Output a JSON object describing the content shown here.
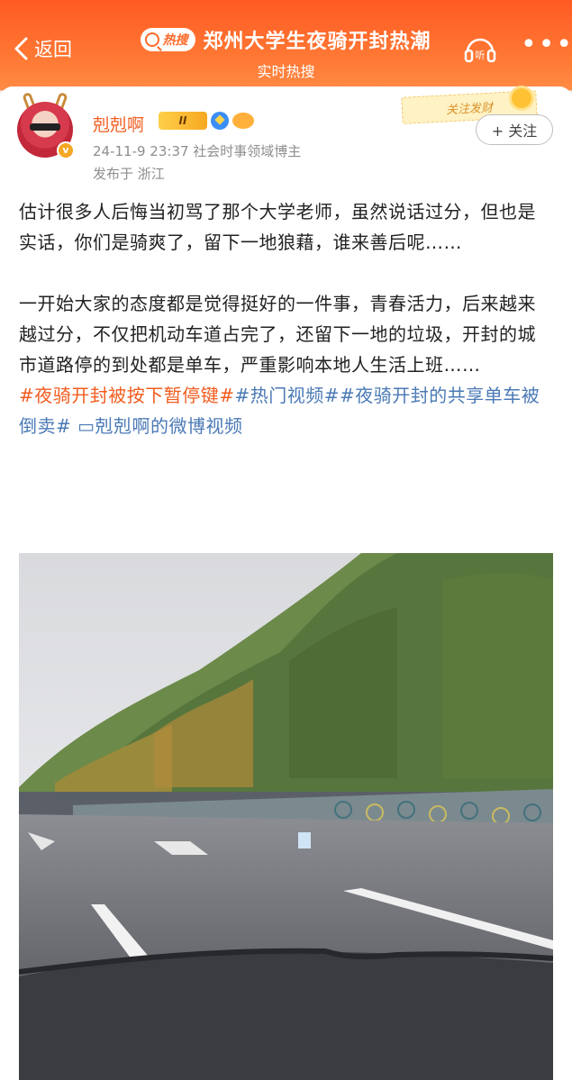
{
  "header": {
    "back_label": "返回",
    "hot_badge": "热搜",
    "title": "郑州大学生夜骑开封热潮",
    "subtitle": "实时热搜",
    "listen_label": "听",
    "more_label": "•••"
  },
  "post": {
    "username": "剋剋啊",
    "level_badge": "II",
    "banner_text": "关注发财",
    "follow_label": "+ 关注",
    "meta_line": "24-11-9 23:37  社会时事领域博主",
    "location": "发布于 浙江",
    "paragraph1": "估计很多人后悔当初骂了那个大学老师，虽然说话过分，但也是实话，你们是骑爽了，留下一地狼藉，谁来善后呢……",
    "paragraph2": "一开始大家的态度都是觉得挺好的一件事，青春活力，后来越来越过分，不仅把机动车道占完了，还留下一地的垃圾，开封的城市道路停的到处都是单车，严重影响本地人生活上班……",
    "tags": [
      {
        "text": "#夜骑开封被按下暂停键#",
        "color": "orange"
      },
      {
        "text": "#热门视频#",
        "color": "blue"
      },
      {
        "text": "#夜骑开封的共享单车被倒卖#",
        "color": "blue"
      }
    ],
    "video_link": "剋剋啊的微博视频"
  },
  "colors": {
    "brand_orange": "#ff6a2a",
    "username": "#f25c1f",
    "link_blue": "#4a79b5",
    "meta_gray": "#8e8e8e"
  },
  "icons": {
    "back": "chevron-left-icon",
    "listen": "headphones-icon",
    "more": "more-dots-icon",
    "video": "video-icon"
  }
}
